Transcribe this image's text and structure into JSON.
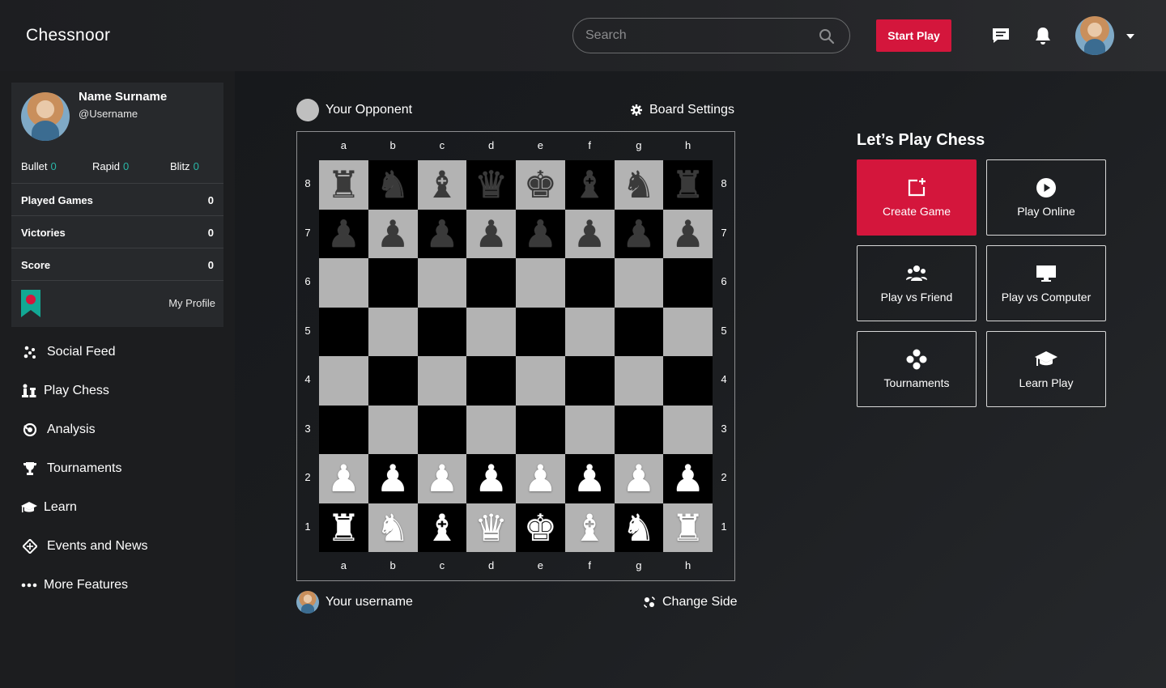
{
  "header": {
    "brand": "Chessnoor",
    "search": {
      "placeholder": "Search"
    },
    "start_play": "Start Play"
  },
  "profile": {
    "name": "Name Surname",
    "username": "@Username",
    "ratings": [
      {
        "label": "Bullet",
        "value": "0"
      },
      {
        "label": "Rapid",
        "value": "0"
      },
      {
        "label": "Blitz",
        "value": "0"
      }
    ],
    "stats": [
      {
        "label": "Played Games",
        "value": "0"
      },
      {
        "label": "Victories",
        "value": "0"
      },
      {
        "label": "Score",
        "value": "0"
      }
    ],
    "my_profile": "My Profile"
  },
  "sidebar": {
    "items": [
      {
        "label": "Social Feed",
        "icon": "social-feed-icon"
      },
      {
        "label": "Play Chess",
        "icon": "chess-pieces-icon"
      },
      {
        "label": "Analysis",
        "icon": "analysis-icon"
      },
      {
        "label": "Tournaments",
        "icon": "trophy-icon"
      },
      {
        "label": "Learn",
        "icon": "graduation-cap-icon"
      },
      {
        "label": "Events and News",
        "icon": "news-icon"
      },
      {
        "label": "More Features",
        "icon": "more-dots-icon"
      }
    ]
  },
  "game": {
    "opponent": "Your Opponent",
    "board_settings": "Board Settings",
    "player": "Your username",
    "change_side": "Change Side",
    "files": [
      "a",
      "b",
      "c",
      "d",
      "e",
      "f",
      "g",
      "h"
    ],
    "ranks": [
      "8",
      "7",
      "6",
      "5",
      "4",
      "3",
      "2",
      "1"
    ],
    "position": [
      [
        "br",
        "bn",
        "bb",
        "bq",
        "bk",
        "bb",
        "bn",
        "br"
      ],
      [
        "bp",
        "bp",
        "bp",
        "bp",
        "bp",
        "bp",
        "bp",
        "bp"
      ],
      [
        "",
        "",
        "",
        "",
        "",
        "",
        "",
        ""
      ],
      [
        "",
        "",
        "",
        "",
        "",
        "",
        "",
        ""
      ],
      [
        "",
        "",
        "",
        "",
        "",
        "",
        "",
        ""
      ],
      [
        "",
        "",
        "",
        "",
        "",
        "",
        "",
        ""
      ],
      [
        "wp",
        "wp",
        "wp",
        "wp",
        "wp",
        "wp",
        "wp",
        "wp"
      ],
      [
        "wr",
        "wn",
        "wb",
        "wq",
        "wk",
        "wb",
        "wn",
        "wr"
      ]
    ],
    "colors": {
      "light_square": "#b3b3b3",
      "dark_square": "#000000"
    }
  },
  "play_panel": {
    "title": "Let’s Play Chess",
    "tiles": [
      {
        "label": "Create Game",
        "icon": "create-game-icon"
      },
      {
        "label": "Play Online",
        "icon": "play-circle-icon"
      },
      {
        "label": "Play vs Friend",
        "icon": "friends-icon"
      },
      {
        "label": "Play vs Computer",
        "icon": "monitor-icon"
      },
      {
        "label": "Tournaments",
        "icon": "tournament-icon"
      },
      {
        "label": "Learn Play",
        "icon": "graduation-cap-icon"
      }
    ]
  },
  "theme": {
    "accent": "#d4163c",
    "rating_value": "#29b6a7"
  }
}
